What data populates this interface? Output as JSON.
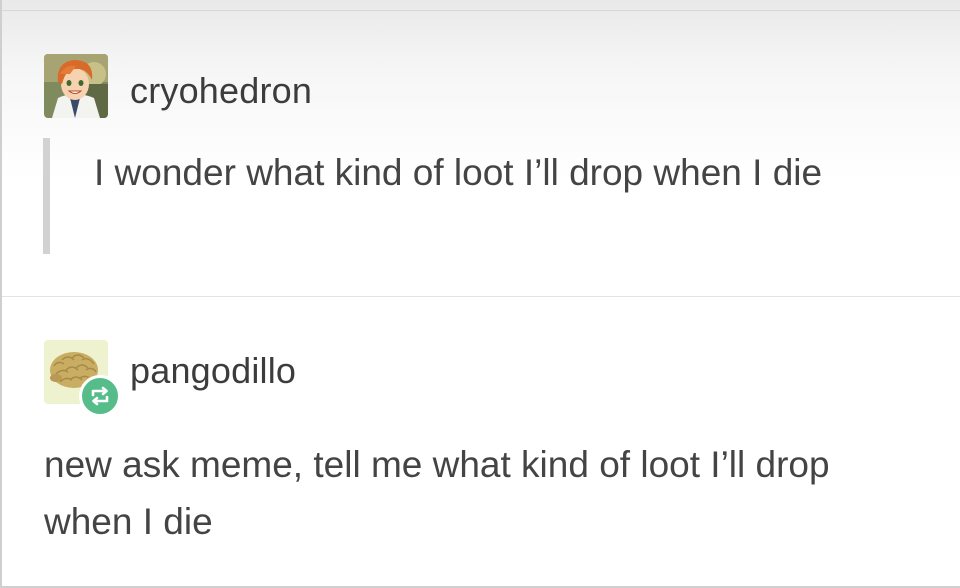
{
  "posts": [
    {
      "username": "cryohedron",
      "avatar_icon": "anime-boy-avatar-icon",
      "body": "I wonder what kind of loot I’ll drop when I die",
      "style": "quote"
    },
    {
      "username": "pangodillo",
      "avatar_icon": "pangolin-avatar-icon",
      "badge_icon": "reblog-icon",
      "badge_color": "#56bc8a",
      "body": "new ask meme, tell me what kind of loot I’ll drop when I die",
      "style": "plain"
    }
  ]
}
